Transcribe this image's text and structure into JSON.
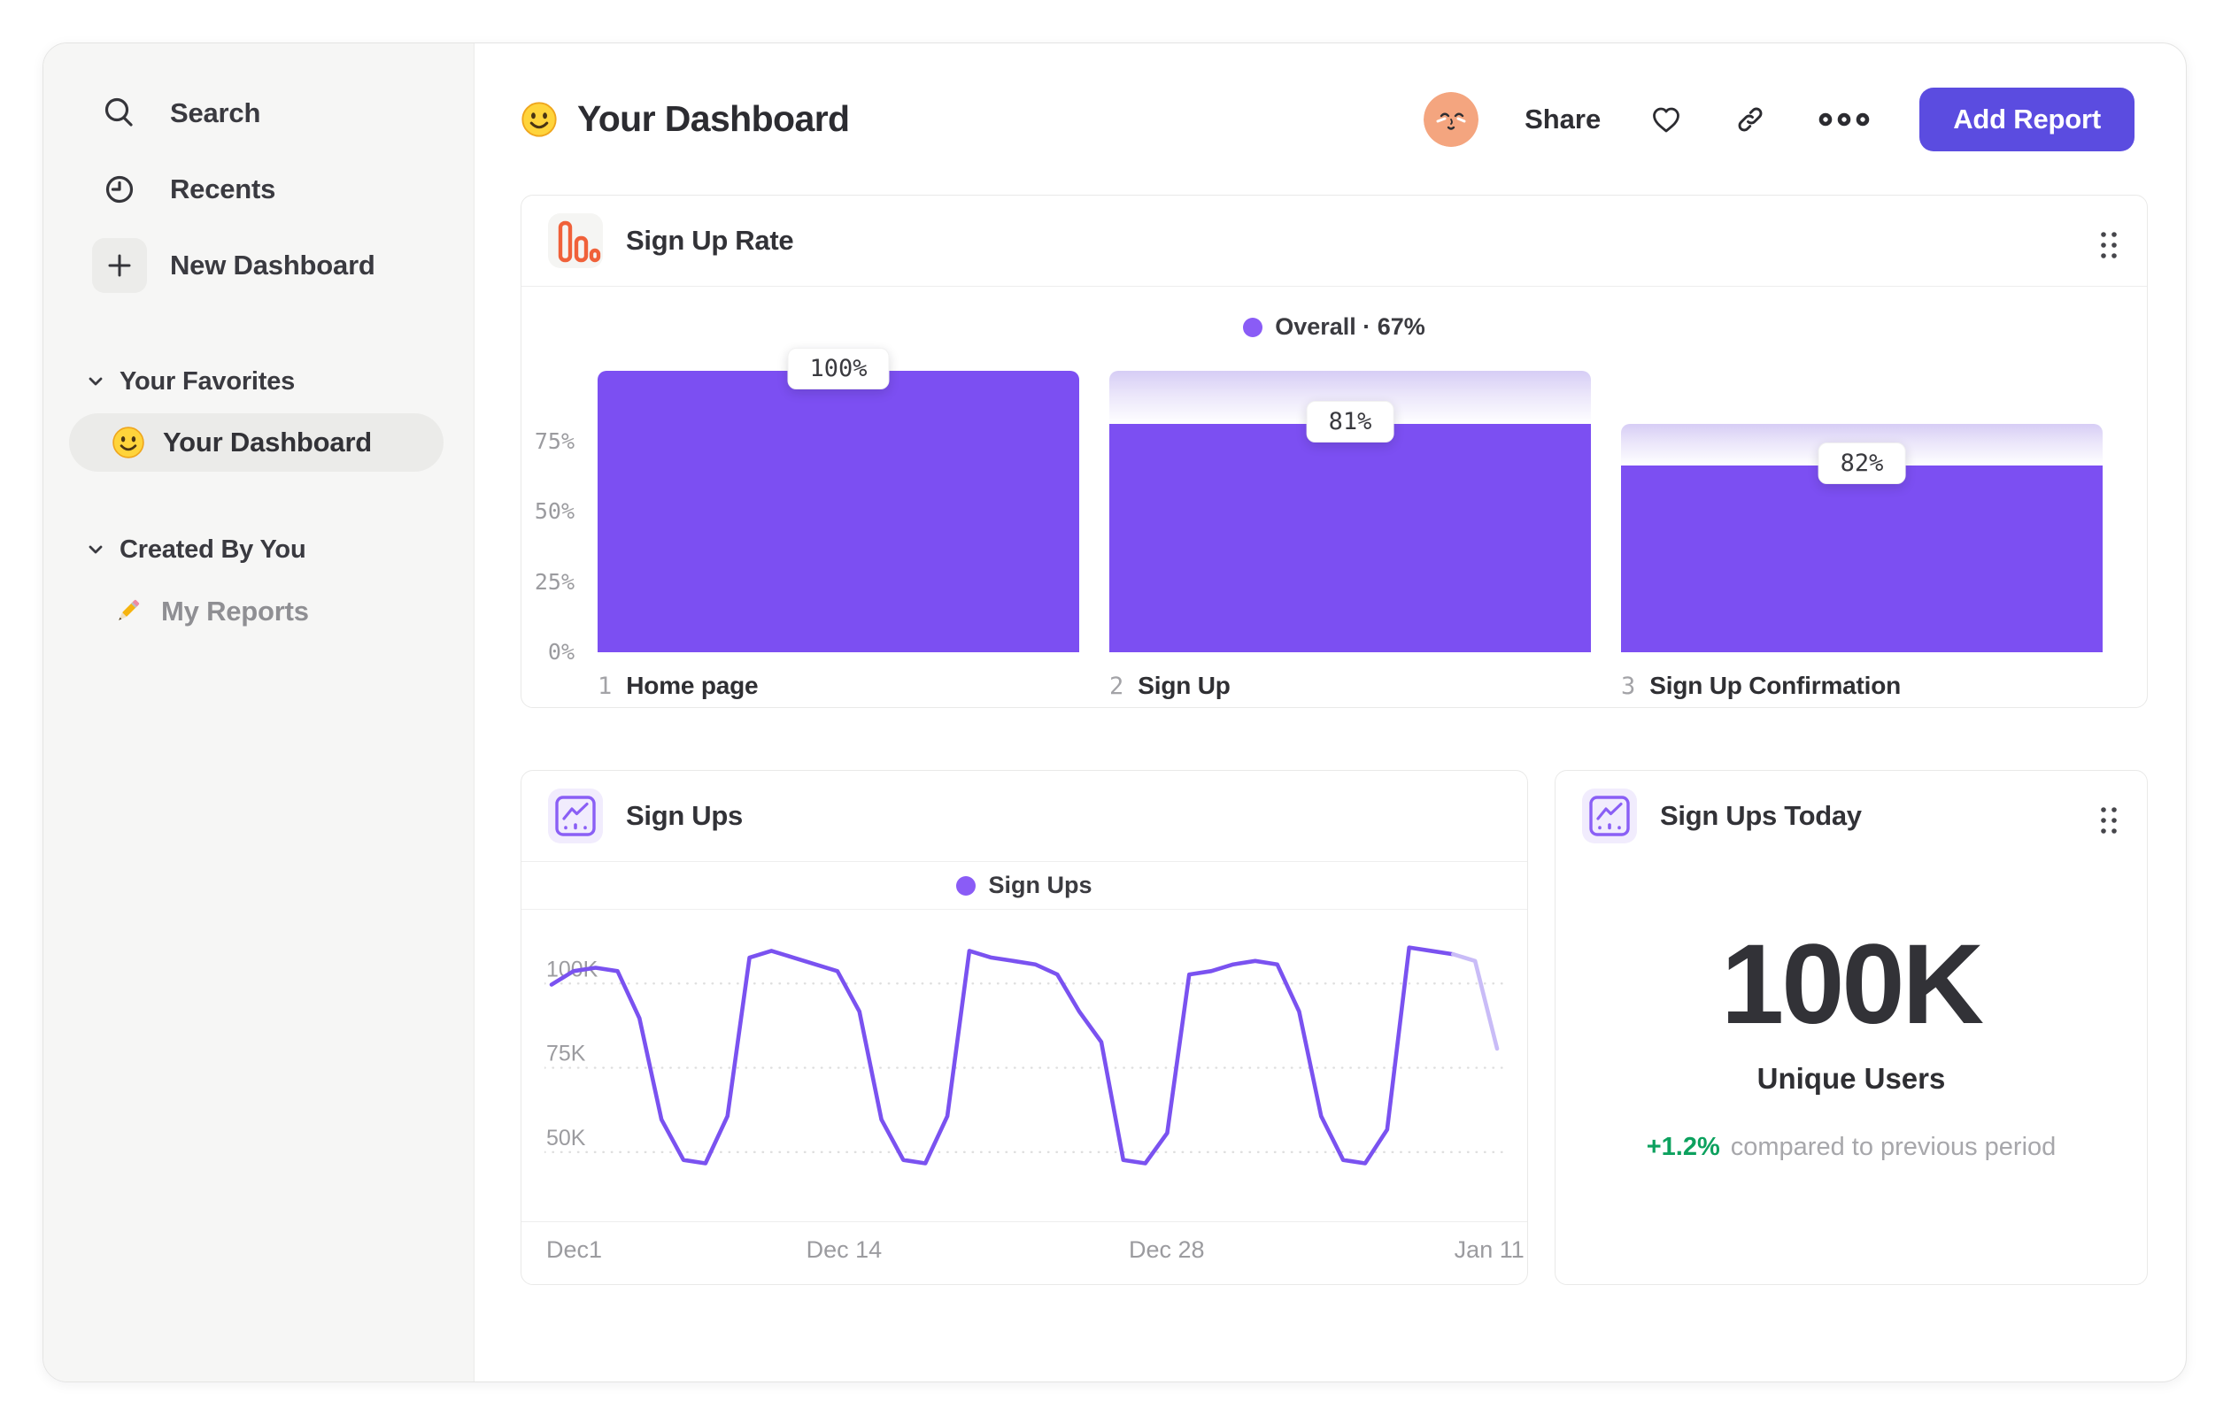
{
  "sidebar": {
    "nav": [
      {
        "icon": "search-icon",
        "label": "Search"
      },
      {
        "icon": "clock-icon",
        "label": "Recents"
      },
      {
        "icon": "plus-icon",
        "label": "New Dashboard"
      }
    ],
    "sections": [
      {
        "title": "Your Favorites",
        "items": [
          {
            "icon": "smiley-emoji",
            "label": "Your Dashboard",
            "selected": true
          }
        ]
      },
      {
        "title": "Created By You",
        "items": [
          {
            "icon": "pencil-emoji",
            "label": "My Reports",
            "selected": false
          }
        ]
      }
    ]
  },
  "header": {
    "title_emoji": "smiley-emoji",
    "title": "Your Dashboard",
    "share_label": "Share",
    "add_report_label": "Add Report",
    "icons": [
      "avatar",
      "heart-icon",
      "link-icon",
      "ellipsis-icon"
    ]
  },
  "colors": {
    "accent_purple_bar": "#7c4ff2",
    "accent_purple_line": "#7a52f0",
    "accent_purple_dot": "#8a5cf6",
    "button_purple": "#5b4ce0",
    "icon_orange": "#f0613a",
    "positive_green": "#0ca15e",
    "sidebar_bg": "#f6f6f5",
    "text_dark": "#323237",
    "text_gray": "#9b9b9f"
  },
  "chart_data": [
    {
      "type": "bar",
      "variant": "funnel",
      "title": "Sign Up Rate",
      "legend": {
        "series": "Overall",
        "value": "67%",
        "display": "Overall · 67%"
      },
      "categories": [
        "Home page",
        "Sign Up",
        "Sign Up Confirmation"
      ],
      "category_indices": [
        "1",
        "2",
        "3"
      ],
      "values": [
        100,
        81,
        82
      ],
      "value_labels": [
        "100%",
        "81%",
        "82%"
      ],
      "cumulative_pct": [
        100,
        81,
        66.4
      ],
      "y_ticks": [
        {
          "label": "75%",
          "value": 75
        },
        {
          "label": "50%",
          "value": 50
        },
        {
          "label": "25%",
          "value": 25
        },
        {
          "label": "0%",
          "value": 0
        }
      ],
      "ylim": [
        0,
        100
      ],
      "bar_color": "#7c4ff2"
    },
    {
      "type": "line",
      "title": "Sign Ups",
      "legend": "Sign Ups",
      "x_tick_labels": [
        "Dec1",
        "Dec 14",
        "Dec 28",
        "Jan 11"
      ],
      "x_tick_days": [
        0,
        13,
        27,
        41
      ],
      "total_days": 43,
      "unit": "thousands",
      "values_thousands": [
        96,
        100,
        101,
        100,
        86,
        56,
        44,
        43,
        57,
        104,
        106,
        104,
        102,
        100,
        88,
        56,
        44,
        43,
        57,
        106,
        104,
        103,
        102,
        99,
        88,
        79,
        44,
        43,
        52,
        99,
        100,
        102,
        103,
        102,
        88,
        57,
        44,
        43,
        53,
        107,
        106,
        105,
        103,
        77
      ],
      "y_ticks": [
        {
          "label": "100K",
          "value": 100
        },
        {
          "label": "75K",
          "value": 75
        },
        {
          "label": "50K",
          "value": 50
        }
      ],
      "y_domain_thousands": [
        28,
        116
      ],
      "faded_from_index": 41,
      "line_color": "#7a52f0",
      "faded_line_color": "#c9bcf7",
      "grid": "dotted-horizontal",
      "legend_position": "top-center"
    },
    {
      "type": "metric",
      "title": "Sign Ups Today",
      "value": "100K",
      "label": "Unique Users",
      "delta": "+1.2%",
      "delta_direction": "up",
      "context": "compared to previous period"
    }
  ]
}
